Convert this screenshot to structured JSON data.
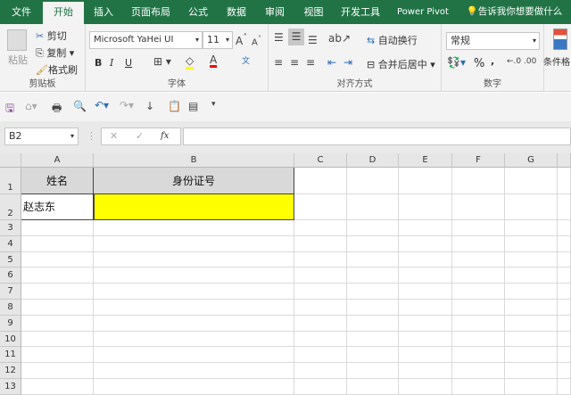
{
  "tabs": [
    "文件",
    "开始",
    "插入",
    "页面布局",
    "公式",
    "数据",
    "审阅",
    "视图",
    "开发工具",
    "Power Pivot"
  ],
  "tell_me": "告诉我你想要做什么",
  "clipboard": {
    "paste": "粘贴",
    "cut": "剪切",
    "copy": "复制",
    "format_painter": "格式刷",
    "label": "剪贴板"
  },
  "font": {
    "name": "Microsoft YaHei UI",
    "size": "11",
    "bold": "B",
    "italic": "I",
    "underline": "U",
    "label": "字体",
    "fill_color": "#ffff00",
    "font_color": "#ff0000"
  },
  "alignment": {
    "wrap": "自动换行",
    "merge": "合并后居中",
    "label": "对齐方式"
  },
  "number": {
    "format": "常规",
    "percent": "%",
    "comma": ",",
    "label": "数字"
  },
  "styles": {
    "conditional": "条件格"
  },
  "formula_bar": {
    "name_box": "B2",
    "fx": "fx",
    "value": ""
  },
  "columns": [
    "A",
    "B",
    "C",
    "D",
    "E",
    "F",
    "G"
  ],
  "rows": [
    "1",
    "2",
    "3",
    "4",
    "5",
    "6",
    "7",
    "8",
    "9",
    "10",
    "11",
    "12",
    "13"
  ],
  "cells": {
    "A1": "姓名",
    "B1": "身份证号",
    "A2": "赵志东",
    "B2": ""
  },
  "colors": {
    "accent": "#217346",
    "header_fill": "#d9d9d9",
    "highlight": "#ffff00"
  }
}
